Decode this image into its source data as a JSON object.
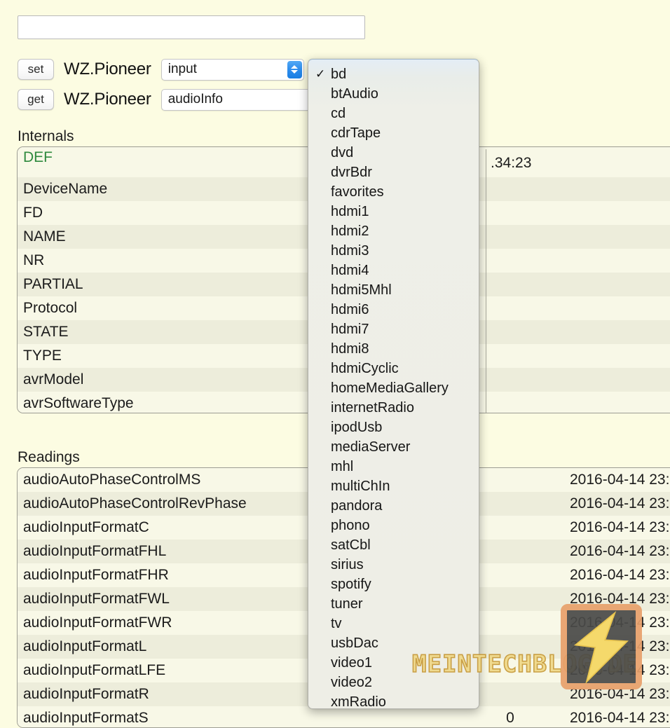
{
  "command_input": {
    "value": "",
    "placeholder": ""
  },
  "set_row": {
    "button_label": "set",
    "device": "WZ.Pioneer",
    "select_value": "input"
  },
  "get_row": {
    "button_label": "get",
    "device": "WZ.Pioneer",
    "select_value": "audioInfo"
  },
  "input_menu": {
    "selected": "bd",
    "checkmark": "✓",
    "options": [
      "bd",
      "btAudio",
      "cd",
      "cdrTape",
      "dvd",
      "dvrBdr",
      "favorites",
      "hdmi1",
      "hdmi2",
      "hdmi3",
      "hdmi4",
      "hdmi5Mhl",
      "hdmi6",
      "hdmi7",
      "hdmi8",
      "hdmiCyclic",
      "homeMediaGallery",
      "internetRadio",
      "ipodUsb",
      "mediaServer",
      "mhl",
      "multiChIn",
      "pandora",
      "phono",
      "satCbl",
      "sirius",
      "spotify",
      "tuner",
      "tv",
      "usbDac",
      "video1",
      "video2",
      "xmRadio"
    ]
  },
  "internals": {
    "title": "Internals",
    "rows": [
      {
        "key": "DEF",
        "value": "",
        "link": true
      },
      {
        "key": "DeviceName",
        "value": "",
        "link": false
      },
      {
        "key": "FD",
        "value": "",
        "link": false
      },
      {
        "key": "NAME",
        "value": "",
        "link": false
      },
      {
        "key": "NR",
        "value": "",
        "link": false
      },
      {
        "key": "PARTIAL",
        "value": "",
        "link": false
      },
      {
        "key": "Protocol",
        "value": "",
        "link": false
      },
      {
        "key": "STATE",
        "value": "",
        "link": false
      },
      {
        "key": "TYPE",
        "value": "",
        "link": false
      },
      {
        "key": "avrModel",
        "value": "",
        "link": false
      },
      {
        "key": "avrSoftwareType",
        "value": "",
        "link": false
      }
    ],
    "def_value_visible": ".34:23"
  },
  "readings": {
    "title": "Readings",
    "rows": [
      {
        "key": "audioAutoPhaseControlMS",
        "value": "",
        "time": "2016-04-14 23:"
      },
      {
        "key": "audioAutoPhaseControlRevPhase",
        "value": "",
        "time": "2016-04-14 23:"
      },
      {
        "key": "audioInputFormatC",
        "value": "",
        "time": "2016-04-14 23:"
      },
      {
        "key": "audioInputFormatFHL",
        "value": "",
        "time": "2016-04-14 23:"
      },
      {
        "key": "audioInputFormatFHR",
        "value": "",
        "time": "2016-04-14 23:"
      },
      {
        "key": "audioInputFormatFWL",
        "value": "",
        "time": "2016-04-14 23:"
      },
      {
        "key": "audioInputFormatFWR",
        "value": "",
        "time": "2016-04-14 23:"
      },
      {
        "key": "audioInputFormatL",
        "value": "",
        "time": "2016-04-14 23:"
      },
      {
        "key": "audioInputFormatLFE",
        "value": "",
        "time": "2016-04-14 23:"
      },
      {
        "key": "audioInputFormatR",
        "value": "",
        "time": "2016-04-14 23:"
      },
      {
        "key": "audioInputFormatS",
        "value": "0",
        "time": "2016-04-14 23:"
      }
    ]
  },
  "watermark": {
    "text": "MEINTECHBLOG.DE"
  },
  "colors": {
    "page_background": "#fcfce2",
    "row_odd": "#f8f8e7",
    "row_even": "#ededdb",
    "table_border": "#9d9d93",
    "link_green": "#2f8a3e",
    "stepper_blue": "#2d8ded",
    "menu_background": "#eeeee6",
    "watermark_yellow": "#f0d98a",
    "watermark_orange": "#e8a06b"
  }
}
